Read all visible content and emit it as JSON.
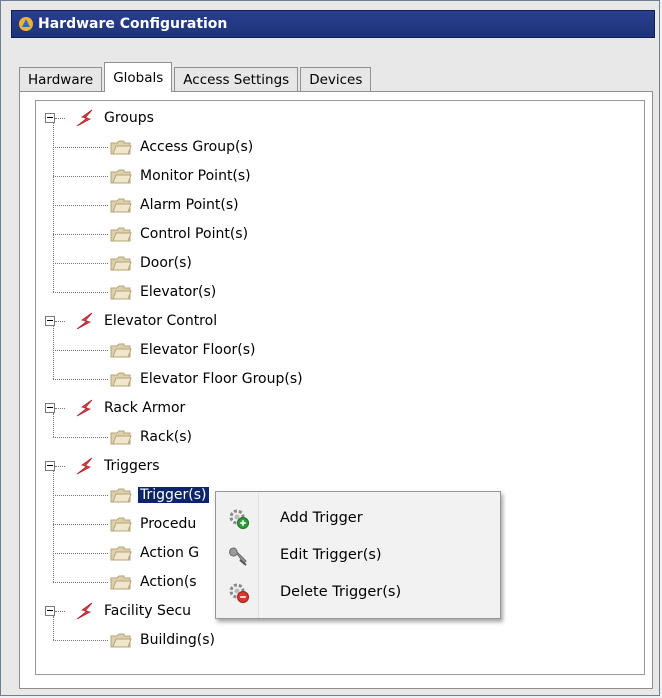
{
  "window": {
    "title": "Hardware Configuration"
  },
  "tabs": [
    {
      "label": "Hardware",
      "active": false
    },
    {
      "label": "Globals",
      "active": true
    },
    {
      "label": "Access Settings",
      "active": false
    },
    {
      "label": "Devices",
      "active": false
    }
  ],
  "tree": {
    "groups": [
      {
        "label": "Groups",
        "children": [
          "Access Group(s)",
          "Monitor Point(s)",
          "Alarm Point(s)",
          "Control Point(s)",
          "Door(s)",
          "Elevator(s)"
        ]
      },
      {
        "label": "Elevator Control",
        "children": [
          "Elevator Floor(s)",
          "Elevator Floor Group(s)"
        ]
      },
      {
        "label": "Rack Armor",
        "children": [
          "Rack(s)"
        ]
      },
      {
        "label": "Triggers",
        "children": [
          "Trigger(s)",
          "Procedu",
          "Action G",
          "Action(s"
        ]
      },
      {
        "label": "Facility Secu",
        "children": [
          "Building(s)"
        ]
      }
    ],
    "selected_label": "Trigger(s)"
  },
  "context_menu": {
    "items": [
      {
        "label": "Add Trigger",
        "icon": "gear-add-icon"
      },
      {
        "label": "Edit Trigger(s)",
        "icon": "wrench-icon"
      },
      {
        "label": "Delete Trigger(s)",
        "icon": "gear-delete-icon"
      }
    ]
  },
  "colors": {
    "titlebar": "#1d3377",
    "selection": "#0b246a",
    "root_icon": "#e8424a",
    "folder": "#e2d6b6"
  }
}
